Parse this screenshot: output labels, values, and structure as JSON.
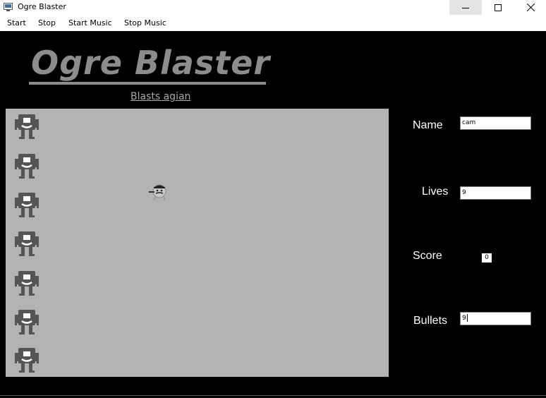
{
  "window": {
    "title": "Ogre Blaster",
    "icon": "app-window-icon",
    "controls": {
      "minimize": "minimize-icon",
      "maximize": "maximize-icon",
      "close": "close-icon"
    }
  },
  "menu": {
    "items": [
      {
        "label": "Start"
      },
      {
        "label": "Stop"
      },
      {
        "label": "Start Music"
      },
      {
        "label": "Stop Music"
      }
    ]
  },
  "header": {
    "title": "Ogre Blaster",
    "subtitle": "Blasts agian"
  },
  "game": {
    "ogre_count": 7,
    "colors": {
      "field": "#b3b3b3",
      "ogre": "#555555",
      "title": "#8c8c8c"
    }
  },
  "stats": {
    "name_label": "Name",
    "name_value": "cam",
    "lives_label": "Lives",
    "lives_value": "9",
    "score_label": "Score",
    "score_value": "0",
    "bullets_label": "Bullets",
    "bullets_value": "9"
  }
}
